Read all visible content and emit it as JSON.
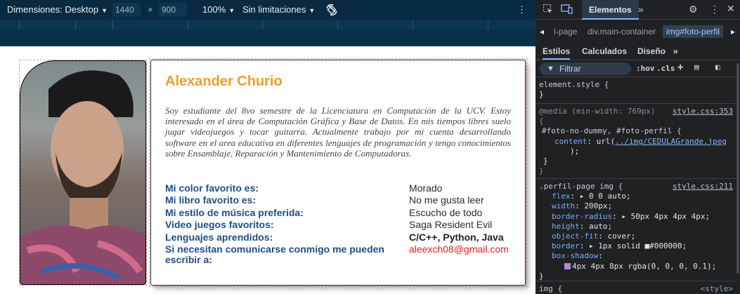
{
  "toolbar": {
    "dimensions_label": "Dimensiones: Desktop",
    "width_value": "1440",
    "times": "×",
    "height_value": "900",
    "zoom": "100%",
    "throttle": "Sin limitaciones",
    "more_glyph": "⋮"
  },
  "page": {
    "name": "Alexander Churio",
    "bio": "Soy estudiante del 8vo semestre de la Licenciatura en Computación de la UCV. Estoy interesado en el área de Computación Gráfica y Base de Datos. En mis tiempos libres suelo jugar videojuegos y tocar guitarra. Actualmente trabajo por mi cuenta desarrollando software en el area educativa en diferentes lenguajes de programación y tengo conocimientos sobre Ensamblaje, Reparación y Mantenimiento de Computadoras.",
    "facts": [
      {
        "q": "Mi color favorito es:",
        "a": "Morado"
      },
      {
        "q": "Mi libro favorito es:",
        "a": "No me gusta leer"
      },
      {
        "q": "Mi estilo de música preferida:",
        "a": "Escucho de todo"
      },
      {
        "q": "Video juegos favoritos:",
        "a": "Saga Resident Evil"
      },
      {
        "q": "Lenguajes aprendidos:",
        "a": "C/C++, Python, Java"
      },
      {
        "q": "Si necesitan comunicarse conmigo me pueden escribir a:",
        "a": "aleexch08@gmail.com"
      }
    ],
    "accent_color": "#f39c29",
    "label_color": "#1f4e84",
    "email_color": "#e0202a"
  },
  "devtools": {
    "tab_active": "Elementos",
    "breadcrumbs": [
      "l-page",
      "div.main-container",
      "img#foto-perfil"
    ],
    "sub_tabs": [
      "Estilos",
      "Calculados",
      "Diseño"
    ],
    "filter_placeholder": "Filtrar",
    "hov": ":hov",
    "cls": ".cls",
    "rules": {
      "element_style": "element.style {",
      "close": "}",
      "media": "@media (min-width: 769px)",
      "media_brace": "{",
      "media_link": "style.css:353",
      "media_selector": "#foto-no-dummy, #foto-perfil {",
      "content_prop": "content",
      "content_pre": "url(",
      "content_url": "../img/CEDULAGrande.jpeg",
      "content_post": ");",
      "inner_close": "}",
      "perfil_selector": ".perfil-page img {",
      "perfil_link": "style.css:211",
      "props": [
        {
          "p": "flex",
          "v": "▸ 0 0 auto;"
        },
        {
          "p": "width",
          "v": "200px;"
        },
        {
          "p": "border-radius",
          "v": "▸ 50px 4px 4px 4px;"
        },
        {
          "p": "height",
          "v": "auto;"
        },
        {
          "p": "object-fit",
          "v": "cover;"
        },
        {
          "p": "border",
          "v": "▸ 1px solid ■#000000;"
        },
        {
          "p": "box-shadow",
          "v": ""
        },
        {
          "p": "",
          "v": "4px 4px 8px rgba(0, 0, 0, 0.1);"
        }
      ],
      "img_selector": "img {",
      "img_link": "<style>"
    }
  }
}
